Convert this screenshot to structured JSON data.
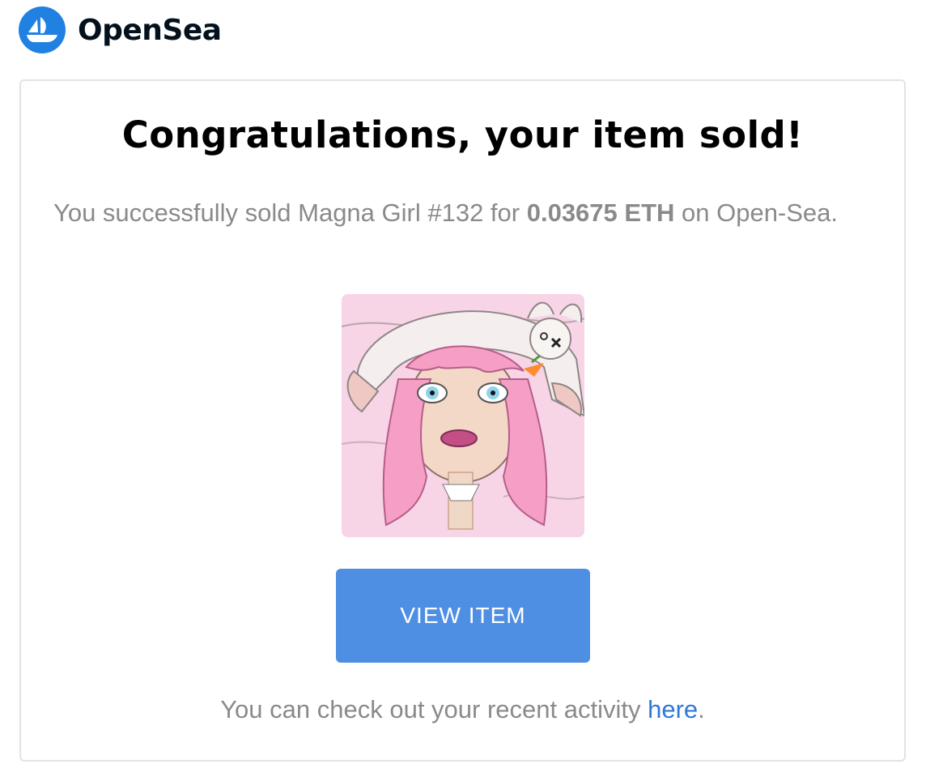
{
  "brand": {
    "name": "OpenSea",
    "logo_icon": "opensea-boat-icon",
    "logo_color": "#2081e2"
  },
  "email": {
    "title": "Congratulations, your item sold!",
    "message_prefix": "You successfully sold Magna Girl #132 for ",
    "amount": "0.03675 ETH",
    "message_suffix": " on Open-Sea.",
    "nft_image_alt": "Magna Girl #132",
    "view_button_label": "VIEW ITEM",
    "footer_prefix": "You can check out your recent activity ",
    "footer_link": "here",
    "footer_suffix": "."
  },
  "colors": {
    "button": "#4f8fe3",
    "link": "#2f79d7",
    "body_text": "#8a8a8a"
  }
}
